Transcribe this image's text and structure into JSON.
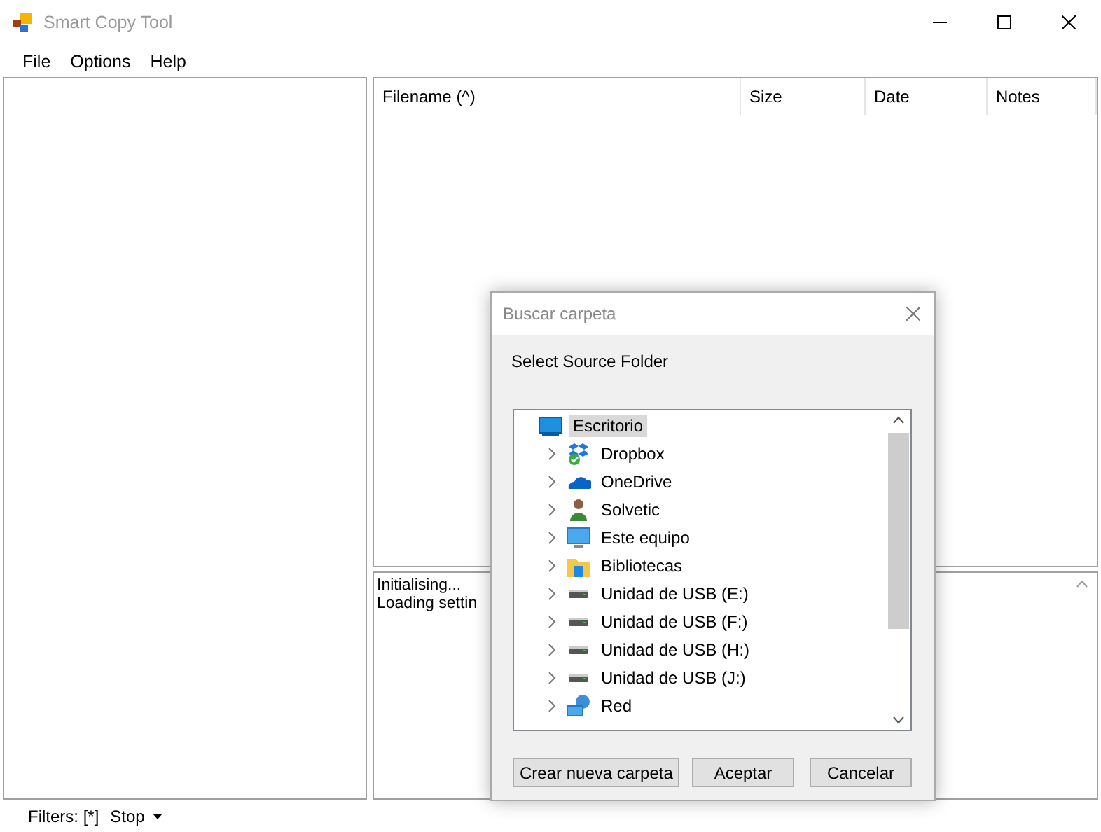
{
  "window": {
    "title": "Smart Copy Tool"
  },
  "menu": [
    "File",
    "Options",
    "Help"
  ],
  "file_list": {
    "columns": [
      "Filename (^)",
      "Size",
      "Date",
      "Notes"
    ]
  },
  "log": [
    "Initialising...",
    "Loading settin"
  ],
  "status_bar": {
    "filters": "Filters: [*]",
    "stop_button": "Stop"
  },
  "dialog": {
    "title": "Buscar carpeta",
    "prompt": "Select Source Folder",
    "tree": {
      "label": "Escritorio",
      "kind": "desktop",
      "selected": true,
      "children": [
        {
          "label": "Dropbox",
          "kind": "dropbox",
          "selected": false,
          "expanded": false
        },
        {
          "label": "OneDrive",
          "kind": "cloud",
          "selected": false,
          "expanded": false
        },
        {
          "label": "Solvetic",
          "kind": "user",
          "selected": false,
          "expanded": false
        },
        {
          "label": "Este equipo",
          "kind": "computer",
          "selected": false,
          "expanded": false
        },
        {
          "label": "Bibliotecas",
          "kind": "library",
          "selected": false,
          "expanded": false
        },
        {
          "label": "Unidad de USB (E:)",
          "kind": "drive",
          "selected": false,
          "expanded": false
        },
        {
          "label": "Unidad de USB (F:)",
          "kind": "drive",
          "selected": false,
          "expanded": false
        },
        {
          "label": "Unidad de USB (H:)",
          "kind": "drive",
          "selected": false,
          "expanded": false
        },
        {
          "label": "Unidad de USB (J:)",
          "kind": "drive",
          "selected": false,
          "expanded": false
        },
        {
          "label": "Red",
          "kind": "network",
          "selected": false,
          "expanded": false
        }
      ]
    },
    "buttons": [
      "Crear nueva carpeta",
      "Aceptar",
      "Cancelar"
    ]
  }
}
